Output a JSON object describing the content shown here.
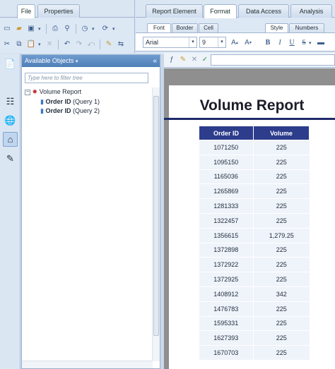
{
  "left_tabs": [
    {
      "label": "File",
      "active": true
    },
    {
      "label": "Properties",
      "active": false
    }
  ],
  "right_tabs": [
    {
      "label": "Report Element",
      "active": false
    },
    {
      "label": "Format",
      "active": true
    },
    {
      "label": "Data Access",
      "active": false
    },
    {
      "label": "Analysis",
      "active": false
    }
  ],
  "format_subtabs": [
    {
      "label": "Font",
      "active": true
    },
    {
      "label": "Border",
      "active": false
    },
    {
      "label": "Cell",
      "active": false
    },
    {
      "label": "Style",
      "active": true
    },
    {
      "label": "Numbers",
      "active": false
    }
  ],
  "font": {
    "family": "Arial",
    "size": "9"
  },
  "style_buttons": {
    "bold": "B",
    "italic": "I",
    "underline": "U",
    "strike": "S"
  },
  "panel": {
    "title": "Available Objects",
    "filter_placeholder": "Type here to filter tree",
    "tree": {
      "root": "Volume Report",
      "items": [
        {
          "name": "Order ID",
          "query": "(Query 1)"
        },
        {
          "name": "Order ID",
          "query": "(Query 2)"
        }
      ]
    }
  },
  "report": {
    "title": "Volume Report",
    "columns": [
      "Order ID",
      "Volume"
    ],
    "rows": [
      [
        "1071250",
        "225"
      ],
      [
        "1095150",
        "225"
      ],
      [
        "1165036",
        "225"
      ],
      [
        "1265869",
        "225"
      ],
      [
        "1281333",
        "225"
      ],
      [
        "1322457",
        "225"
      ],
      [
        "1356615",
        "1,279.25"
      ],
      [
        "1372898",
        "225"
      ],
      [
        "1372922",
        "225"
      ],
      [
        "1372925",
        "225"
      ],
      [
        "1408912",
        "342"
      ],
      [
        "1476783",
        "225"
      ],
      [
        "1595331",
        "225"
      ],
      [
        "1627393",
        "225"
      ],
      [
        "1670703",
        "225"
      ]
    ]
  },
  "colors": {
    "header_blue": "#2d3d8c",
    "panel_header": "#4f7fb8",
    "cell_bg": "#eff3fa",
    "report_bg": "#8f8f8f"
  }
}
